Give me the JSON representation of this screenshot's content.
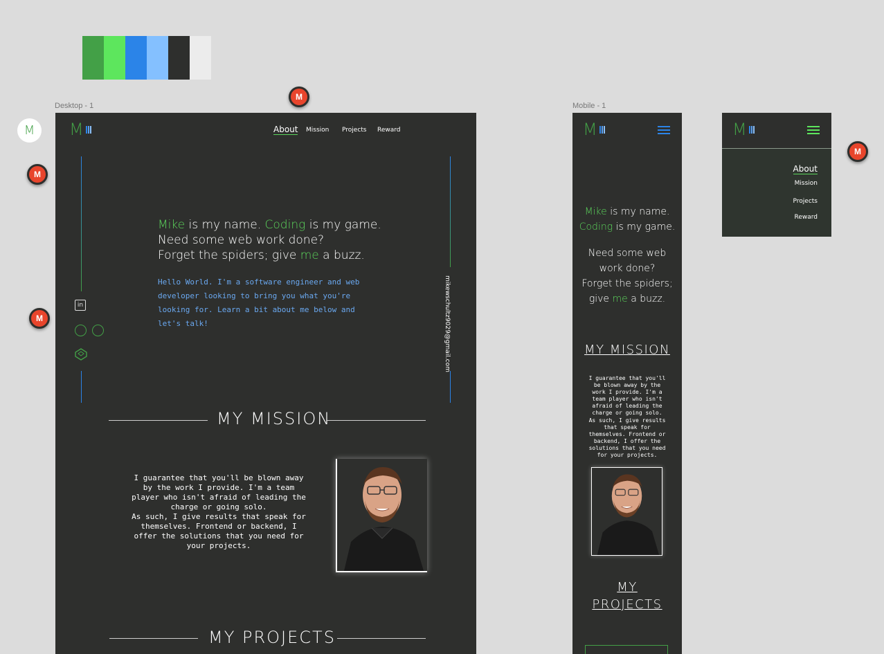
{
  "palette": [
    "#43a047",
    "#5de65d",
    "#2b84e8",
    "#84c0ff",
    "#2e2f2d",
    "#ececec"
  ],
  "frames": {
    "desktop_label": "Desktop - 1",
    "mobile_label": "Mobile - 1"
  },
  "markers": {
    "letter": "M"
  },
  "avatar": {
    "letter": "M"
  },
  "desktop": {
    "logo": "M",
    "nav": [
      "About",
      "Mission",
      "Projects",
      "Reward"
    ],
    "hero": {
      "line1_a": "Mike",
      "line1_b": " is my name. ",
      "line1_c": "Coding",
      "line1_d": " is my game.",
      "line2": "Need some web work done?",
      "line3_a": "Forget the spiders; give ",
      "line3_b": "me",
      "line3_c": " a buzz."
    },
    "intro": "Hello World. I'm a software engineer and web developer looking to bring you what you're looking for. Learn a bit about me below and let's talk!",
    "email": "mikewschultz9029@gmail.com",
    "social_icons": [
      "linkedin-icon",
      "github-icon",
      "github-icon",
      "codepen-icon"
    ],
    "mission_heading": "MY MISSION",
    "mission_p1": "I guarantee that you'll be blown away by the work I provide. I'm a team player who isn't afraid of leading the charge or going solo.",
    "mission_p2": "As such, I give results that speak for themselves. Frontend or backend, I offer the solutions that you need for your projects.",
    "projects_heading": "MY PROJECTS"
  },
  "mobile": {
    "logo": "M",
    "hero": {
      "line1_a": "Mike",
      "line1_b": " is my name.",
      "line2_a": "Coding",
      "line2_b": " is my game.",
      "line3": "Need some web",
      "line4": "work done?",
      "line5": "Forget the spiders;",
      "line6_a": "give ",
      "line6_b": "me",
      "line6_c": " a buzz."
    },
    "mission_heading": "MY MISSION",
    "mission_p1": "I guarantee that you'll be blown away by the work I provide. I'm a team player who isn't afraid of leading the charge or going solo.",
    "mission_p2": "As such, I give results that speak for themselves. Frontend or backend, I offer the solutions that you need for your projects.",
    "projects_heading_1": "MY",
    "projects_heading_2": "PROJECTS"
  },
  "mobile_menu": {
    "logo": "M",
    "items": [
      "About",
      "Mission",
      "Projects",
      "Reward"
    ]
  }
}
